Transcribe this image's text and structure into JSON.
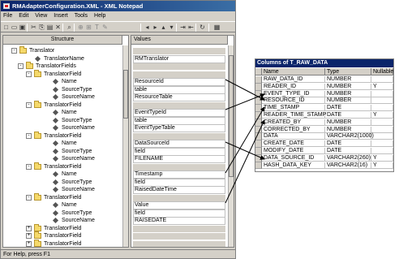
{
  "window": {
    "title": "RMAdapterConfiguration.XML - XML Notepad",
    "menu": [
      "File",
      "Edit",
      "View",
      "Insert",
      "Tools",
      "Help"
    ],
    "status": "For Help, press F1"
  },
  "toolbar_icons": [
    "new-icon",
    "open-icon",
    "save-icon",
    "cut-icon",
    "copy-icon",
    "paste-icon",
    "delete-icon",
    "find-icon",
    "insert-element-icon",
    "insert-attribute-icon",
    "insert-text-icon",
    "insert-comment-icon",
    "move-left-icon",
    "move-right-icon",
    "move-up-icon",
    "move-down-icon",
    "indent-icon",
    "outdent-icon",
    "refresh-icon",
    "view-icon"
  ],
  "structure": {
    "header": "Structure",
    "rows": [
      {
        "label": "Translator",
        "kind": "folder",
        "expander": "-"
      },
      {
        "label": "TranslatorName",
        "kind": "attr"
      },
      {
        "label": "TranslatorFields",
        "kind": "folder",
        "expander": "-"
      },
      {
        "label": "TranslatorField",
        "kind": "folder",
        "expander": "-"
      },
      {
        "label": "Name",
        "kind": "attr"
      },
      {
        "label": "SourceType",
        "kind": "attr"
      },
      {
        "label": "SourceName",
        "kind": "attr"
      },
      {
        "label": "TranslatorField",
        "kind": "folder",
        "expander": "-"
      },
      {
        "label": "Name",
        "kind": "attr"
      },
      {
        "label": "SourceType",
        "kind": "attr"
      },
      {
        "label": "SourceName",
        "kind": "attr"
      },
      {
        "label": "TranslatorField",
        "kind": "folder",
        "expander": "-"
      },
      {
        "label": "Name",
        "kind": "attr"
      },
      {
        "label": "SourceType",
        "kind": "attr"
      },
      {
        "label": "SourceName",
        "kind": "attr"
      },
      {
        "label": "TranslatorField",
        "kind": "folder",
        "expander": "-"
      },
      {
        "label": "Name",
        "kind": "attr"
      },
      {
        "label": "SourceType",
        "kind": "attr"
      },
      {
        "label": "SourceName",
        "kind": "attr"
      },
      {
        "label": "TranslatorField",
        "kind": "folder",
        "expander": "-"
      },
      {
        "label": "Name",
        "kind": "attr"
      },
      {
        "label": "SourceType",
        "kind": "attr"
      },
      {
        "label": "SourceName",
        "kind": "attr"
      },
      {
        "label": "TranslatorField",
        "kind": "folder",
        "expander": "+"
      },
      {
        "label": "TranslatorField",
        "kind": "folder",
        "expander": "+"
      },
      {
        "label": "TranslatorField",
        "kind": "folder",
        "expander": "+"
      }
    ]
  },
  "values": {
    "header": "Values",
    "rows": [
      "",
      "RMTranslator",
      "",
      "",
      "ResourceId",
      "table",
      "ResourceTable",
      "",
      "EventTypeId",
      "table",
      "EventTypeTable",
      "",
      "DataSourceId",
      "field",
      "FILENAME",
      "",
      "Timestamp",
      "field",
      "RaisedDateTime",
      "",
      "Value",
      "field",
      "RAISEDATE",
      "",
      "",
      ""
    ]
  },
  "table": {
    "title": "Columns of T_RAW_DATA",
    "headers": [
      "Name",
      "Type",
      "Nullable"
    ],
    "rows": [
      [
        "RAW_DATA_ID",
        "NUMBER",
        ""
      ],
      [
        "READER_ID",
        "NUMBER",
        "Y"
      ],
      [
        "EVENT_TYPE_ID",
        "NUMBER",
        ""
      ],
      [
        "RESOURCE_ID",
        "NUMBER",
        ""
      ],
      [
        "TIME_STAMP",
        "DATE",
        ""
      ],
      [
        "READER_TIME_STAMP",
        "DATE",
        "Y"
      ],
      [
        "CREATED_BY",
        "NUMBER",
        ""
      ],
      [
        "CORRECTED_BY",
        "NUMBER",
        ""
      ],
      [
        "DATA",
        "VARCHAR2(1000)",
        ""
      ],
      [
        "CREATE_DATE",
        "DATE",
        ""
      ],
      [
        "MODIFY_DATE",
        "DATE",
        ""
      ],
      [
        "DATA_SOURCE_ID",
        "VARCHAR2(260)",
        "Y"
      ],
      [
        "HASH_DATA_KEY",
        "VARCHAR2(16)",
        "Y"
      ]
    ]
  }
}
